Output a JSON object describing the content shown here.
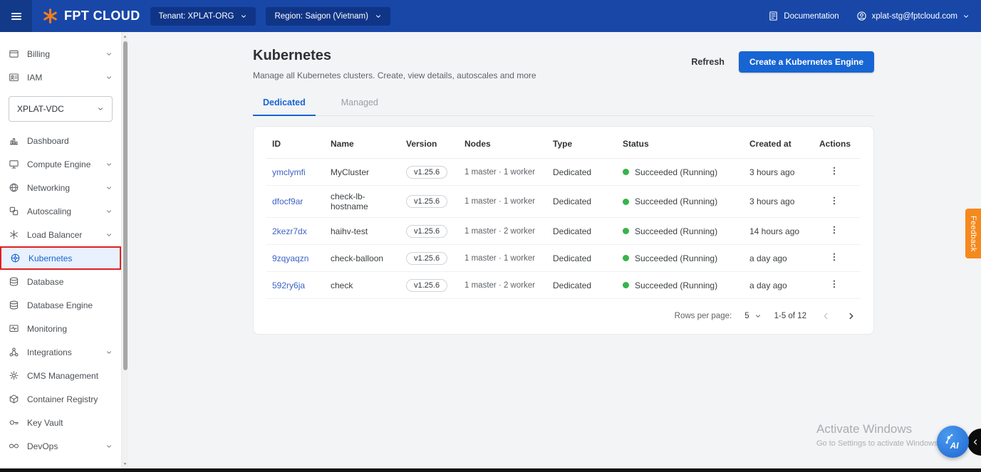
{
  "colors": {
    "topbar": "#1847a8",
    "accent": "#1765d3",
    "link": "#3e63c6",
    "success": "#36b44a",
    "feedback": "#f5891d",
    "annotation": "#e02020",
    "page-bg": "#f3f4f6"
  },
  "topbar": {
    "logo_text": "FPT CLOUD",
    "tenant_label": "Tenant: XPLAT-ORG",
    "region_label": "Region: Saigon (Vietnam)",
    "documentation_label": "Documentation",
    "account_label": "xplat-stg@fptcloud.com"
  },
  "sidebar": {
    "top_items": [
      {
        "label": "Billing",
        "icon": "billing-icon",
        "expandable": true
      },
      {
        "label": "IAM",
        "icon": "iam-icon",
        "expandable": true
      }
    ],
    "vdc_selector": "XPLAT-VDC",
    "items": [
      {
        "label": "Dashboard",
        "icon": "dashboard-icon",
        "expandable": false
      },
      {
        "label": "Compute Engine",
        "icon": "compute-engine-icon",
        "expandable": true
      },
      {
        "label": "Networking",
        "icon": "networking-icon",
        "expandable": true
      },
      {
        "label": "Autoscaling",
        "icon": "autoscaling-icon",
        "expandable": true
      },
      {
        "label": "Load Balancer",
        "icon": "load-balancer-icon",
        "expandable": true
      },
      {
        "label": "Kubernetes",
        "icon": "kubernetes-icon",
        "expandable": false,
        "active": true
      },
      {
        "label": "Database",
        "icon": "database-icon",
        "expandable": false
      },
      {
        "label": "Database Engine",
        "icon": "database-engine-icon",
        "expandable": false
      },
      {
        "label": "Monitoring",
        "icon": "monitoring-icon",
        "expandable": false
      },
      {
        "label": "Integrations",
        "icon": "integrations-icon",
        "expandable": true
      },
      {
        "label": "CMS Management",
        "icon": "cms-management-icon",
        "expandable": false
      },
      {
        "label": "Container Registry",
        "icon": "container-registry-icon",
        "expandable": false
      },
      {
        "label": "Key Vault",
        "icon": "key-vault-icon",
        "expandable": false
      },
      {
        "label": "DevOps",
        "icon": "devops-icon",
        "expandable": true
      }
    ]
  },
  "main": {
    "title": "Kubernetes",
    "subtitle": "Manage all Kubernetes clusters. Create, view details, autoscales and more",
    "refresh_label": "Refresh",
    "create_button_label": "Create a Kubernetes Engine",
    "tabs": [
      {
        "label": "Dedicated",
        "active": true
      },
      {
        "label": "Managed",
        "active": false
      }
    ],
    "table": {
      "columns": [
        "ID",
        "Name",
        "Version",
        "Nodes",
        "Type",
        "Status",
        "Created at",
        "Actions"
      ],
      "rows": [
        {
          "id": "ymclymfi",
          "name": "MyCluster",
          "version": "v1.25.6",
          "nodes": "1 master · 1 worker",
          "type": "Dedicated",
          "status": "Succeeded (Running)",
          "created_at": "3 hours ago"
        },
        {
          "id": "dfocf9ar",
          "name": "check-lb-hostname",
          "version": "v1.25.6",
          "nodes": "1 master · 1 worker",
          "type": "Dedicated",
          "status": "Succeeded (Running)",
          "created_at": "3 hours ago"
        },
        {
          "id": "2kezr7dx",
          "name": "haihv-test",
          "version": "v1.25.6",
          "nodes": "1 master · 2 worker",
          "type": "Dedicated",
          "status": "Succeeded (Running)",
          "created_at": "14 hours ago"
        },
        {
          "id": "9zqyaqzn",
          "name": "check-balloon",
          "version": "v1.25.6",
          "nodes": "1 master · 1 worker",
          "type": "Dedicated",
          "status": "Succeeded (Running)",
          "created_at": "a day ago"
        },
        {
          "id": "592ry6ja",
          "name": "check",
          "version": "v1.25.6",
          "nodes": "1 master · 2 worker",
          "type": "Dedicated",
          "status": "Succeeded (Running)",
          "created_at": "a day ago"
        }
      ]
    },
    "pagination": {
      "rows_per_page_label": "Rows per page:",
      "rows_per_page_value": "5",
      "range_label": "1-5 of 12"
    }
  },
  "feedback_tab_label": "Feedback",
  "watermark": {
    "line1": "Activate Windows",
    "line2": "Go to Settings to activate Windows"
  },
  "ai_button_label": "AI"
}
